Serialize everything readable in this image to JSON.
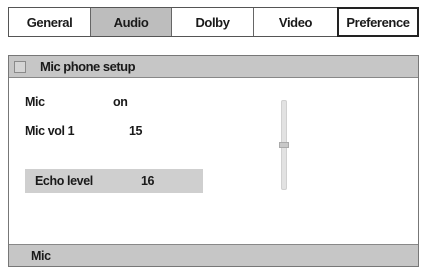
{
  "tabs": [
    {
      "label": "General",
      "active": false
    },
    {
      "label": "Audio",
      "active": true
    },
    {
      "label": "Dolby",
      "active": false
    },
    {
      "label": "Video",
      "active": false
    },
    {
      "label": "Preference",
      "active": false
    }
  ],
  "panel": {
    "title": "Mic phone setup",
    "rows": [
      {
        "label": "Mic",
        "value": "on"
      },
      {
        "label": "Mic  vol 1",
        "value": "15"
      },
      {
        "label": "Echo  level",
        "value": "16",
        "selected": true
      }
    ]
  },
  "slider": {
    "level": 0.5
  },
  "status": {
    "text": "Mic"
  },
  "colors": {
    "active_tab": "#bdbdbd",
    "header_bg": "#c6c6c6",
    "selected_row": "#cfcfcf"
  }
}
